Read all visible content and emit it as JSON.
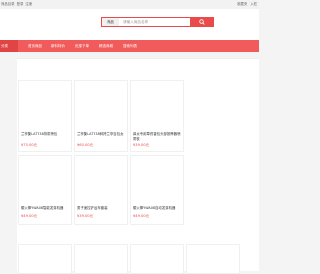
{
  "topbar": {
    "left_items": [
      "商品目录",
      "登录",
      "注册"
    ],
    "right_items": [
      "收藏夹",
      "入驻"
    ]
  },
  "search": {
    "category": "商品",
    "placeholder": "请输入商品名称",
    "button_icon": "search-icon"
  },
  "nav": {
    "category_label": "分类",
    "items": [
      "首页商品",
      "新料特价",
      "优惠下单",
      "精选商城",
      "搜索列表"
    ]
  },
  "products": [
    {
      "title": "兰亭集LAT738背带挎包",
      "price": "¥75.00元"
    },
    {
      "title": "兰亭集LAT738斜挎兰亭百包女",
      "price": "¥60.00元"
    },
    {
      "title": "鼻炎专用草药香包头部按摩器喷雾枕",
      "price": "¥39.00元"
    },
    {
      "title": "耀火棒YWA08智能发芽机器",
      "price": "¥49.00元"
    },
    {
      "title": "男子遥控铲运车套装",
      "price": "¥39.00元"
    },
    {
      "title": "耀火棒YWA08自动发芽机器",
      "price": "¥49.00元"
    }
  ]
}
